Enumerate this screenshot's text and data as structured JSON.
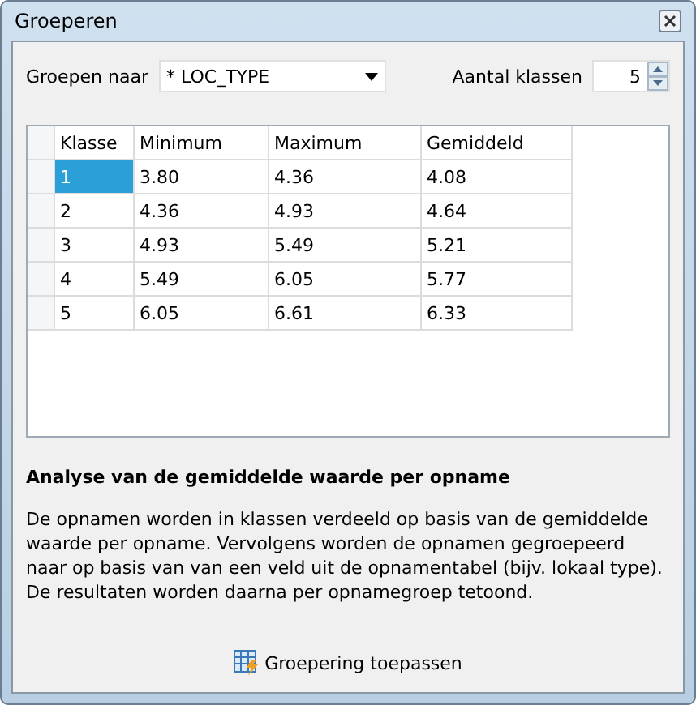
{
  "window": {
    "title": "Groeperen"
  },
  "group_by": {
    "label": "Groepen naar",
    "value": "* LOC_TYPE"
  },
  "class_count": {
    "label": "Aantal klassen",
    "value": "5"
  },
  "table": {
    "columns": [
      "Klasse",
      "Minimum",
      "Maximum",
      "Gemiddeld"
    ],
    "rows": [
      {
        "cells": [
          "1",
          "3.80",
          "4.36",
          "4.08"
        ],
        "selected": true
      },
      {
        "cells": [
          "2",
          "4.36",
          "4.93",
          "4.64"
        ],
        "selected": false
      },
      {
        "cells": [
          "3",
          "4.93",
          "5.49",
          "5.21"
        ],
        "selected": false
      },
      {
        "cells": [
          "4",
          "5.49",
          "6.05",
          "5.77"
        ],
        "selected": false
      },
      {
        "cells": [
          "5",
          "6.05",
          "6.61",
          "6.33"
        ],
        "selected": false
      }
    ]
  },
  "description": {
    "heading": "Analyse van de gemiddelde waarde per opname",
    "paragraphs": [
      "De opnamen worden in klassen verdeeld op basis van de gemiddelde waarde per opname. Vervolgens worden de opnamen gegroepeerd naar op basis van van een veld uit de opnamentabel (bijv. lokaal type).",
      "De resultaten worden daarna per opnamegroep tetoond."
    ]
  },
  "apply_button": {
    "label": "Groepering toepassen"
  }
}
